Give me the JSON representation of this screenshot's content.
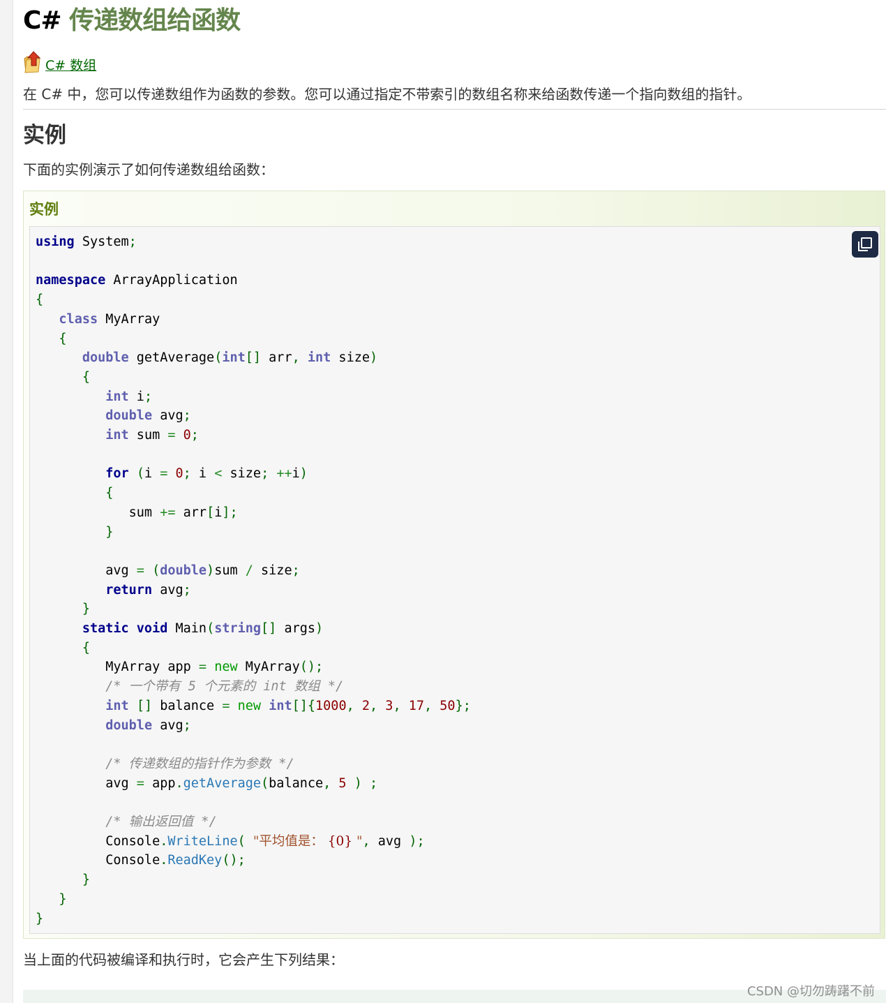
{
  "title": {
    "prefix": "C#",
    "highlight": "传递数组给函数"
  },
  "back_link": {
    "label": "C# 数组",
    "icon": "up-arrow-folder-icon"
  },
  "intro_text": "在 C# 中，您可以传递数组作为函数的参数。您可以通过指定不带索引的数组名称来给函数传递一个指向数组的指针。",
  "section_title": "实例",
  "example_description": "下面的实例演示了如何传递数组给函数：",
  "example_box": {
    "label": "实例",
    "copy_button_icon": "copy-icon",
    "code_lines": [
      "using System;",
      "",
      "namespace ArrayApplication",
      "{",
      "   class MyArray",
      "   {",
      "      double getAverage(int[] arr, int size)",
      "      {",
      "         int i;",
      "         double avg;",
      "         int sum = 0;",
      "",
      "         for (i = 0; i < size; ++i)",
      "         {",
      "            sum += arr[i];",
      "         }",
      "",
      "         avg = (double)sum / size;",
      "         return avg;",
      "      }",
      "      static void Main(string[] args)",
      "      {",
      "         MyArray app = new MyArray();",
      "         /* 一个带有 5 个元素的 int 数组 */",
      "         int [] balance = new int[]{1000, 2, 3, 17, 50};",
      "         double avg;",
      "",
      "         /* 传递数组的指针作为参数 */",
      "         avg = app.getAverage(balance, 5 ) ;",
      "",
      "         /* 输出返回值 */",
      "         Console.WriteLine( \"平均值是： {0} \", avg );",
      "         Console.ReadKey();",
      "      }",
      "   }",
      "}"
    ]
  },
  "output_description": "当上面的代码被编译和执行时，它会产生下列结果：",
  "watermark": "CSDN @切勿踌躇不前",
  "colors": {
    "title_highlight": "#64854c",
    "link": "#006600",
    "example_label": "#617f10",
    "keyword": "#00008b",
    "type_keyword": "#5f5faf",
    "number": "#8b0000",
    "comment": "#8a8a8a"
  }
}
